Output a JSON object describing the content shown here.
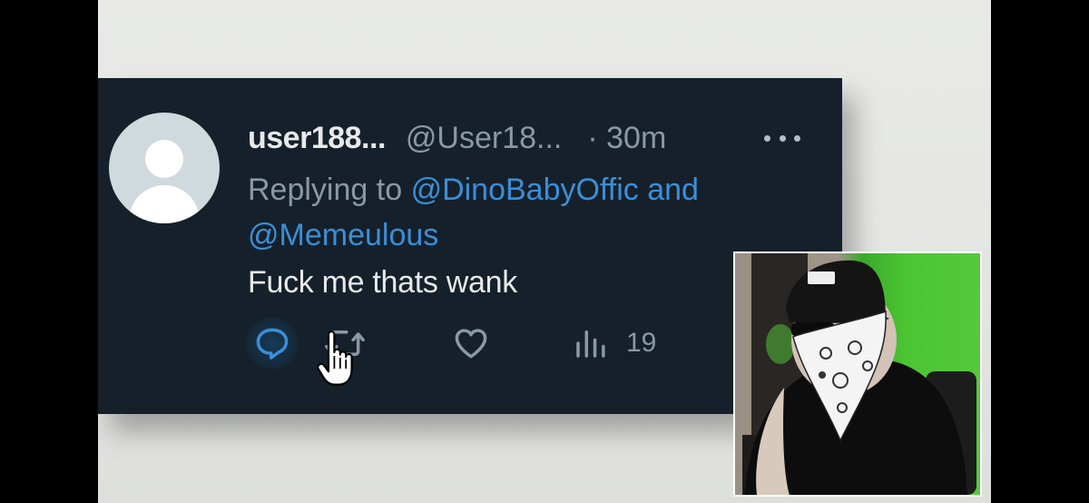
{
  "tweet": {
    "display_name": "user188...",
    "handle": "@User18...",
    "time": "· 30m",
    "reply_prefix": "Replying to",
    "reply_mention_1": "@DinoBabyOffic",
    "reply_and": "and",
    "reply_mention_2": "@Memeulous",
    "text": "Fuck me thats wank",
    "views_count": "19"
  },
  "colors": {
    "card_background": "#15202b",
    "link": "#3a8fd8",
    "muted_text": "#8b98a5",
    "primary_text": "#e7e9ea",
    "reply_highlight": "#1d9bf0"
  },
  "icons": [
    "default-avatar-icon",
    "more-icon",
    "reply-icon",
    "retweet-icon",
    "like-icon",
    "views-icon",
    "hand-cursor-icon"
  ],
  "webcam": {
    "content": "streamer webcam overlay"
  }
}
